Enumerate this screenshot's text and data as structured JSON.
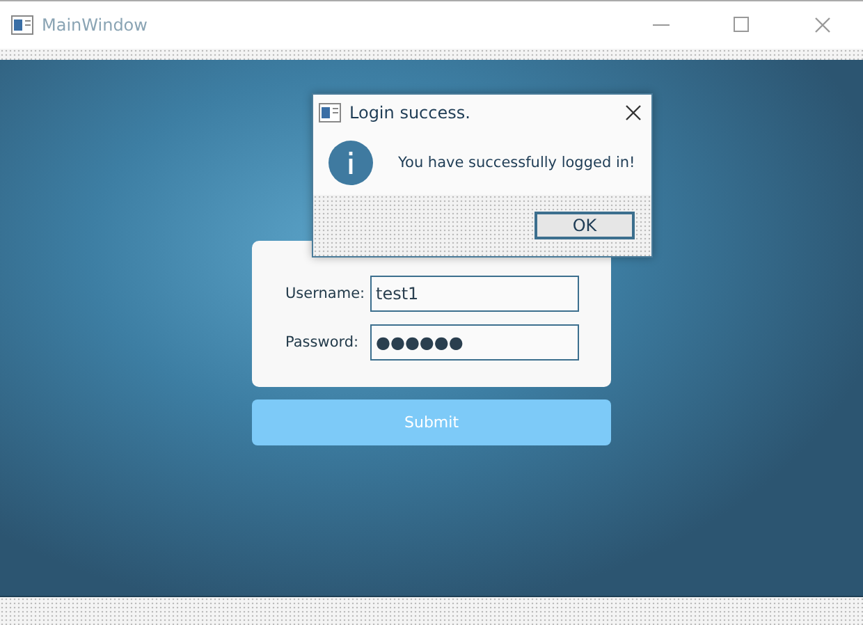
{
  "window": {
    "title": "MainWindow"
  },
  "login_form": {
    "fields": [
      {
        "label": "Username:",
        "value": "test1"
      },
      {
        "label": "Password:",
        "value": "●●●●●●"
      }
    ],
    "submit": "Submit"
  },
  "dialog": {
    "title": "Login success.",
    "message": "You have successfully logged in!",
    "button": "OK"
  }
}
